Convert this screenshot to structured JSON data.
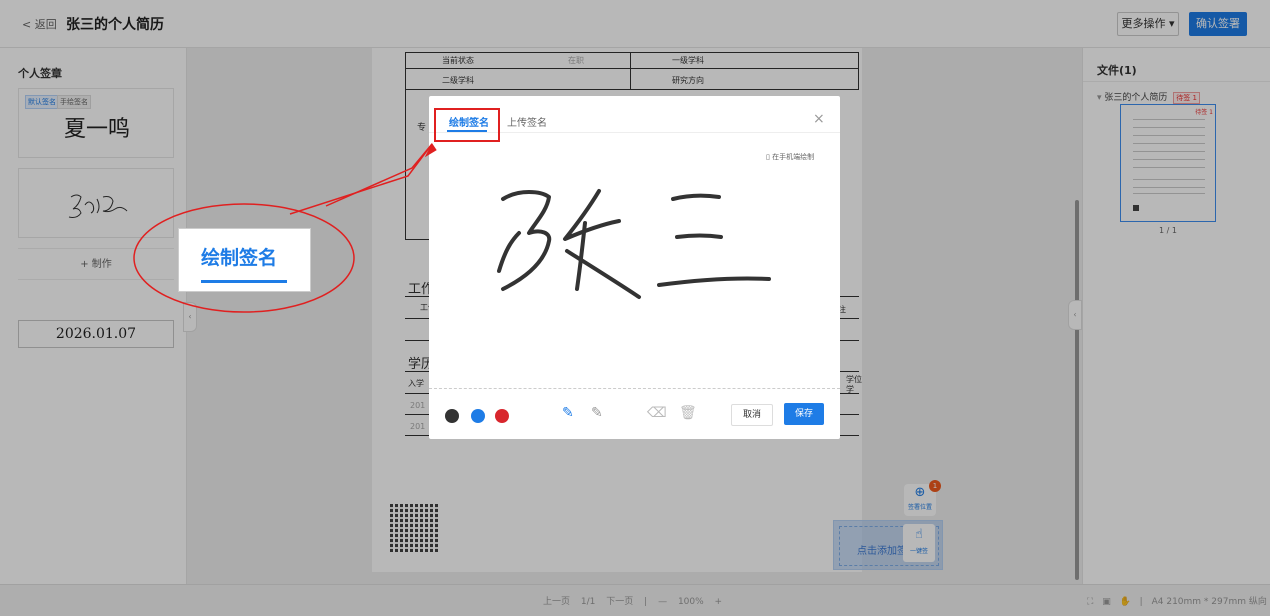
{
  "topbar": {
    "back_label": "< 返回",
    "title": "张三的个人简历",
    "more_label": "更多操作 ▾",
    "confirm_label": "确认签署"
  },
  "left_panel": {
    "title": "个人签章",
    "tags": [
      "默认签名",
      "手绘签名"
    ],
    "sign_name": "夏一鸣",
    "make_label": "+ 制作",
    "date": "2026.01.07"
  },
  "right_panel": {
    "title": "文件(1)",
    "file_name": "张三的个人简历",
    "file_badge": "待签 1",
    "thumb_badge": "待签 1",
    "page_label": "1 / 1"
  },
  "document": {
    "cells": {
      "current_status": "当前状态",
      "current_value": "在职",
      "level1_subject": "一级学科",
      "level2_subject": "二级学科",
      "research": "研究方向",
      "work_section": "工作",
      "edu_section": "学历",
      "work_col": "工作",
      "edu_col": "入学",
      "degree_col": "学位",
      "degree_col2": "学",
      "note_col": "注",
      "year1": "201",
      "year2": "201",
      "side_char": "专"
    }
  },
  "float": {
    "position_label": "签署位置",
    "position_badge": "1",
    "add_label": "点击添加签",
    "one_key_label": "一键签"
  },
  "bottombar": {
    "prev": "上一页",
    "page": "1/1",
    "next": "下一页",
    "zoom_out": "—",
    "zoom": "100%",
    "zoom_in": "+",
    "paper_info": "A4 210mm * 297mm 纵向"
  },
  "modal": {
    "tab_draw": "绘制签名",
    "tab_upload": "上传签名",
    "close": "×",
    "phone_draw": "▯ 在手机端绘制",
    "colors": [
      "#333333",
      "#1e7ce6",
      "#d8262d"
    ],
    "cancel_label": "取消",
    "save_label": "保存"
  },
  "callout": {
    "label": "绘制签名"
  }
}
